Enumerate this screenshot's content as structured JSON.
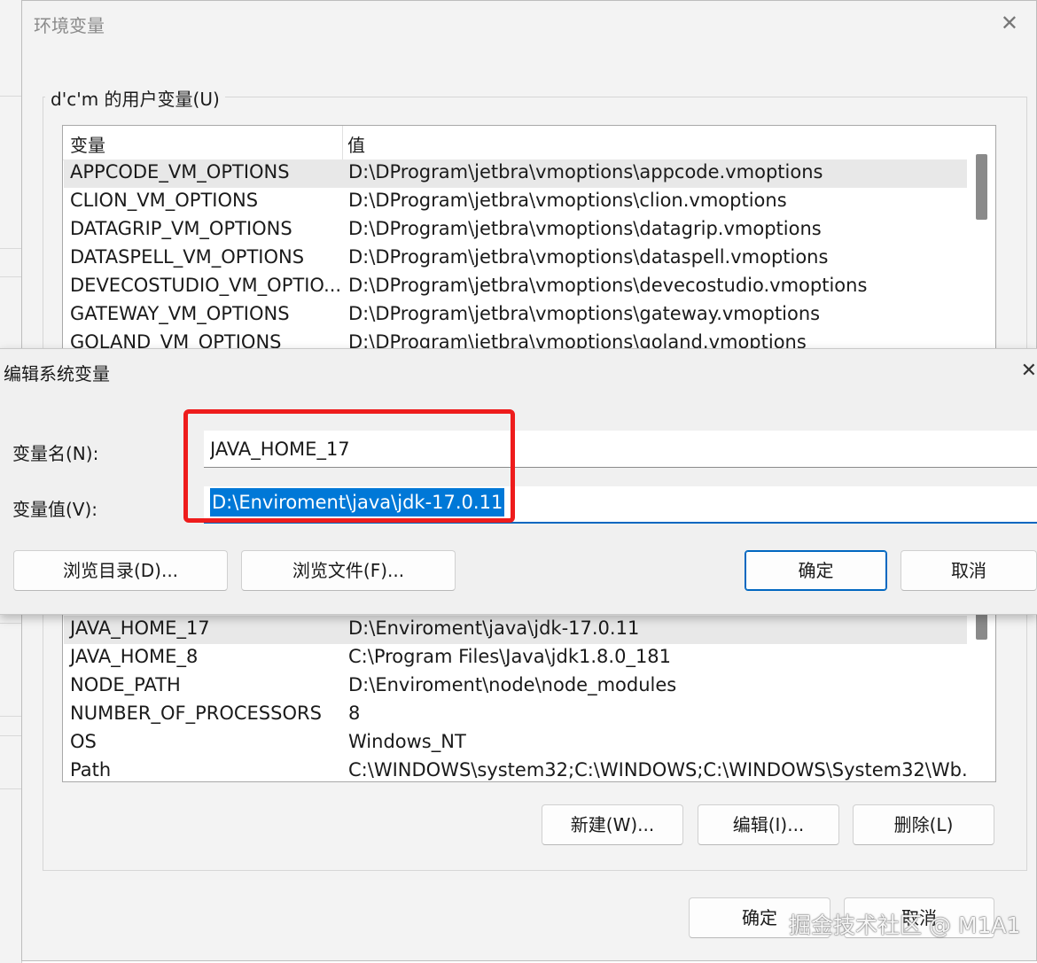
{
  "env_window": {
    "title": "环境变量",
    "close_glyph": "✕",
    "user_group_label": "d'c'm 的用户变量(U)",
    "columns": {
      "name": "变量",
      "value": "值"
    },
    "user_vars": [
      {
        "name": "APPCODE_VM_OPTIONS",
        "value": "D:\\DProgram\\jetbra\\vmoptions\\appcode.vmoptions"
      },
      {
        "name": "CLION_VM_OPTIONS",
        "value": "D:\\DProgram\\jetbra\\vmoptions\\clion.vmoptions"
      },
      {
        "name": "DATAGRIP_VM_OPTIONS",
        "value": "D:\\DProgram\\jetbra\\vmoptions\\datagrip.vmoptions"
      },
      {
        "name": "DATASPELL_VM_OPTIONS",
        "value": "D:\\DProgram\\jetbra\\vmoptions\\dataspell.vmoptions"
      },
      {
        "name": "DEVECOSTUDIO_VM_OPTIO...",
        "value": "D:\\DProgram\\jetbra\\vmoptions\\devecostudio.vmoptions"
      },
      {
        "name": "GATEWAY_VM_OPTIONS",
        "value": "D:\\DProgram\\jetbra\\vmoptions\\gateway.vmoptions"
      },
      {
        "name": "GOLAND_VM_OPTIONS",
        "value": "D:\\DProgram\\jetbra\\vmoptions\\goland.vmoptions"
      }
    ],
    "system_vars": [
      {
        "name": "JAVA_HOME_17",
        "value": "D:\\Enviroment\\java\\jdk-17.0.11"
      },
      {
        "name": "JAVA_HOME_8",
        "value": "C:\\Program Files\\Java\\jdk1.8.0_181"
      },
      {
        "name": "NODE_PATH",
        "value": "D:\\Enviroment\\node\\node_modules"
      },
      {
        "name": "NUMBER_OF_PROCESSORS",
        "value": "8"
      },
      {
        "name": "OS",
        "value": "Windows_NT"
      },
      {
        "name": "Path",
        "value": "C:\\WINDOWS\\system32;C:\\WINDOWS;C:\\WINDOWS\\System32\\Wb..."
      }
    ],
    "buttons": {
      "new": "新建(W)...",
      "edit": "编辑(I)...",
      "delete": "删除(L)",
      "ok": "确定",
      "cancel": "取消"
    }
  },
  "edit_dialog": {
    "title": "编辑系统变量",
    "close_glyph": "✕",
    "name_label": "变量名(N):",
    "value_label": "变量值(V):",
    "name_value": "JAVA_HOME_17",
    "value_value": "D:\\Enviroment\\java\\jdk-17.0.11",
    "buttons": {
      "browse_dir": "浏览目录(D)...",
      "browse_file": "浏览文件(F)...",
      "ok": "确定",
      "cancel": "取消"
    }
  },
  "watermark": "掘金技术社区 @ M1A1",
  "colors": {
    "highlight": "#ee1c1c",
    "selection": "#0078d7",
    "accent": "#0067c0"
  }
}
